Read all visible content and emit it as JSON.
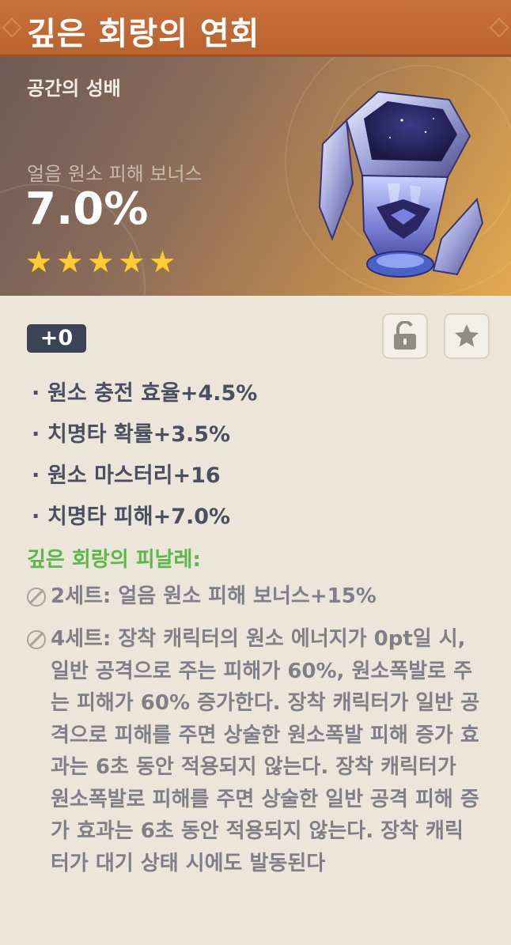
{
  "title": "깊은 회랑의 연회",
  "artifact_type": "공간의 성배",
  "main_stat": {
    "name": "얼음 원소 피해 보너스",
    "value": "7.0%"
  },
  "rarity_stars": 5,
  "stars": [
    "★",
    "★",
    "★",
    "★",
    "★"
  ],
  "level": "+0",
  "buttons": {
    "lock_icon": "unlocked-lock-icon",
    "favorite_icon": "star-icon"
  },
  "substats": [
    "원소 충전 효율+4.5%",
    "치명타 확률+3.5%",
    "원소 마스터리+16",
    "치명타 피해+7.0%"
  ],
  "substat_bullet": "·",
  "set": {
    "name": "깊은 회랑의 피날레:",
    "two_piece": "2세트: 얼음 원소 피해 보너스+15%",
    "four_piece": "4세트: 장착 캐릭터의 원소 에너지가 0pt일 시, 일반 공격으로 주는 피해가 60%, 원소폭발로 주는 피해가 60% 증가한다. 장착 캐릭터가 일반 공격으로 피해를 주면 상술한 원소폭발 피해 증가 효과는 6초 동안 적용되지 않는다. 장착 캐릭터가 원소폭발로 피해를 주면 상술한 일반 공격 피해 증가 효과는 6초 동안 적용되지 않는다. 장착 캐릭터가 대기 상태 시에도 발동된다"
  },
  "colors": {
    "title_bar": "#c06a36",
    "star": "#ffcc32",
    "set_name": "#5cb84a",
    "level_badge": "#3b4354"
  }
}
